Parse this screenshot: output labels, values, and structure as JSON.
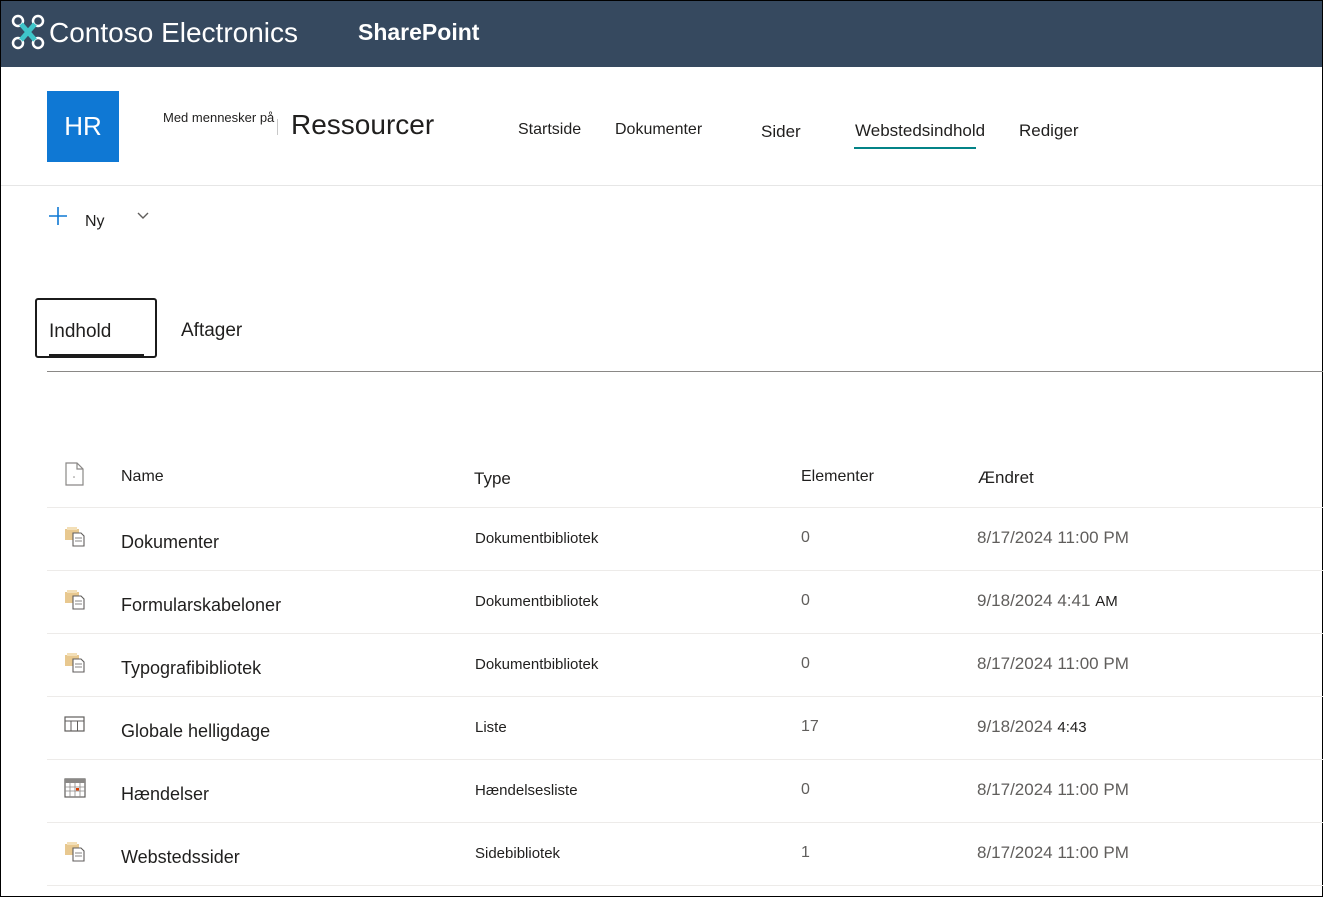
{
  "suite_bar": {
    "brand": "Contoso Electronics",
    "app": "SharePoint",
    "bg_color": "#36495f"
  },
  "site": {
    "logo_text": "HR",
    "logo_color": "#0f78d4",
    "pre_title": "Med mennesker på",
    "title": "Ressourcer",
    "nav": [
      {
        "label": "Startside"
      },
      {
        "label": "Dokumenter"
      },
      {
        "label": "Sider"
      },
      {
        "label": "Webstedsindhold",
        "active": true
      },
      {
        "label": "Rediger"
      }
    ],
    "accent": "#038387"
  },
  "command_bar": {
    "new_label": "Ny",
    "plus_icon": "add-icon",
    "chevron_icon": "chevron-down-icon"
  },
  "tabs": {
    "content": "Indhold",
    "subsites": "Aftager"
  },
  "list": {
    "columns": {
      "name": "Name",
      "type": "Type",
      "items": "Elementer",
      "modified": "Ændret"
    },
    "rows": [
      {
        "icon": "library-icon",
        "name": "Dokumenter",
        "type": "Dokumentbibliotek",
        "items": "0",
        "modified": "8/17/2024 11:00 PM",
        "suffix": ""
      },
      {
        "icon": "library-icon",
        "name": "Formularskabeloner",
        "type": "Dokumentbibliotek",
        "items": "0",
        "modified": "9/18/2024 4:41",
        "suffix": "AM"
      },
      {
        "icon": "library-icon",
        "name": "Typografibibliotek",
        "type": "Dokumentbibliotek",
        "items": "0",
        "modified": "8/17/2024 11:00 PM",
        "suffix": ""
      },
      {
        "icon": "list-icon",
        "name": "Globale helligdage",
        "type": "Liste",
        "items": "17",
        "modified": "9/18/2024",
        "suffix": "4:43"
      },
      {
        "icon": "calendar-icon",
        "name": "Hændelser",
        "type": "Hændelsesliste",
        "items": "0",
        "modified": "8/17/2024 11:00 PM",
        "suffix": ""
      },
      {
        "icon": "library-icon",
        "name": "Webstedssider",
        "type": "Sidebibliotek",
        "items": "1",
        "modified": "8/17/2024 11:00 PM",
        "suffix": ""
      }
    ]
  }
}
